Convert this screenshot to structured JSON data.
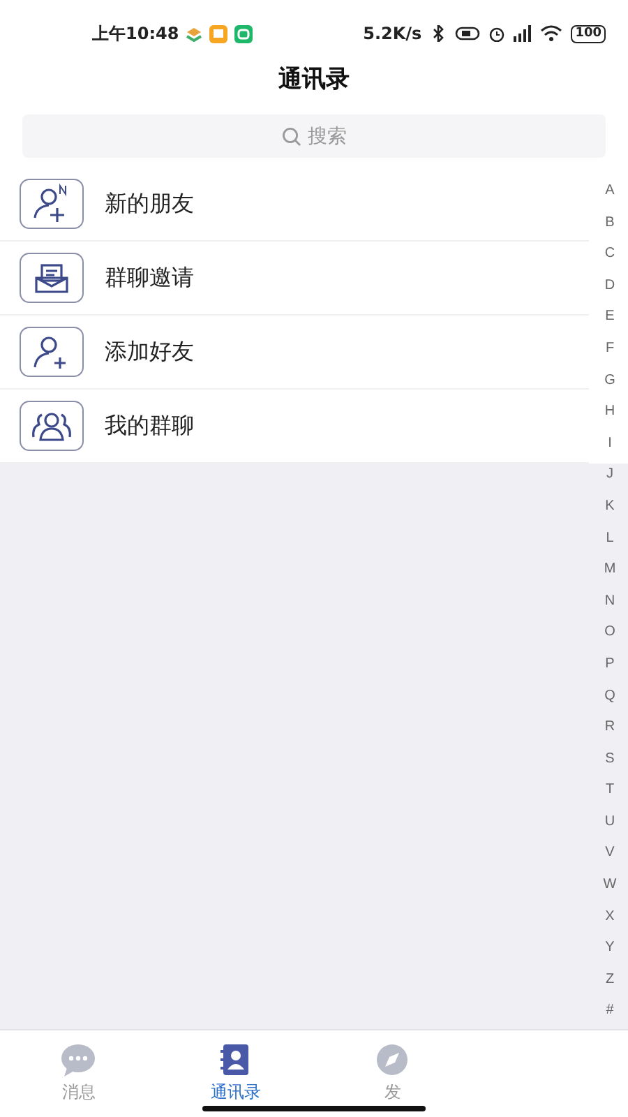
{
  "status_bar": {
    "time": "上午10:48",
    "speed": "5.2K/s",
    "battery": "100"
  },
  "title": "通讯录",
  "search": {
    "placeholder": "搜索"
  },
  "entries": [
    {
      "kind": "new-friend",
      "label": "新的朋友"
    },
    {
      "kind": "invite",
      "label": "群聊邀请"
    },
    {
      "kind": "add",
      "label": "添加好友"
    },
    {
      "kind": "groups",
      "label": "我的群聊"
    }
  ],
  "index_letters": [
    "A",
    "B",
    "C",
    "D",
    "E",
    "F",
    "G",
    "H",
    "I",
    "J",
    "K",
    "L",
    "M",
    "N",
    "O",
    "P",
    "Q",
    "R",
    "S",
    "T",
    "U",
    "V",
    "W",
    "X",
    "Y",
    "Z",
    "#"
  ],
  "tabs": [
    {
      "kind": "chat",
      "label": "消息",
      "selected": false
    },
    {
      "kind": "contacts",
      "label": "通讯录",
      "selected": true
    },
    {
      "kind": "discover",
      "label": "发",
      "selected": false
    }
  ]
}
